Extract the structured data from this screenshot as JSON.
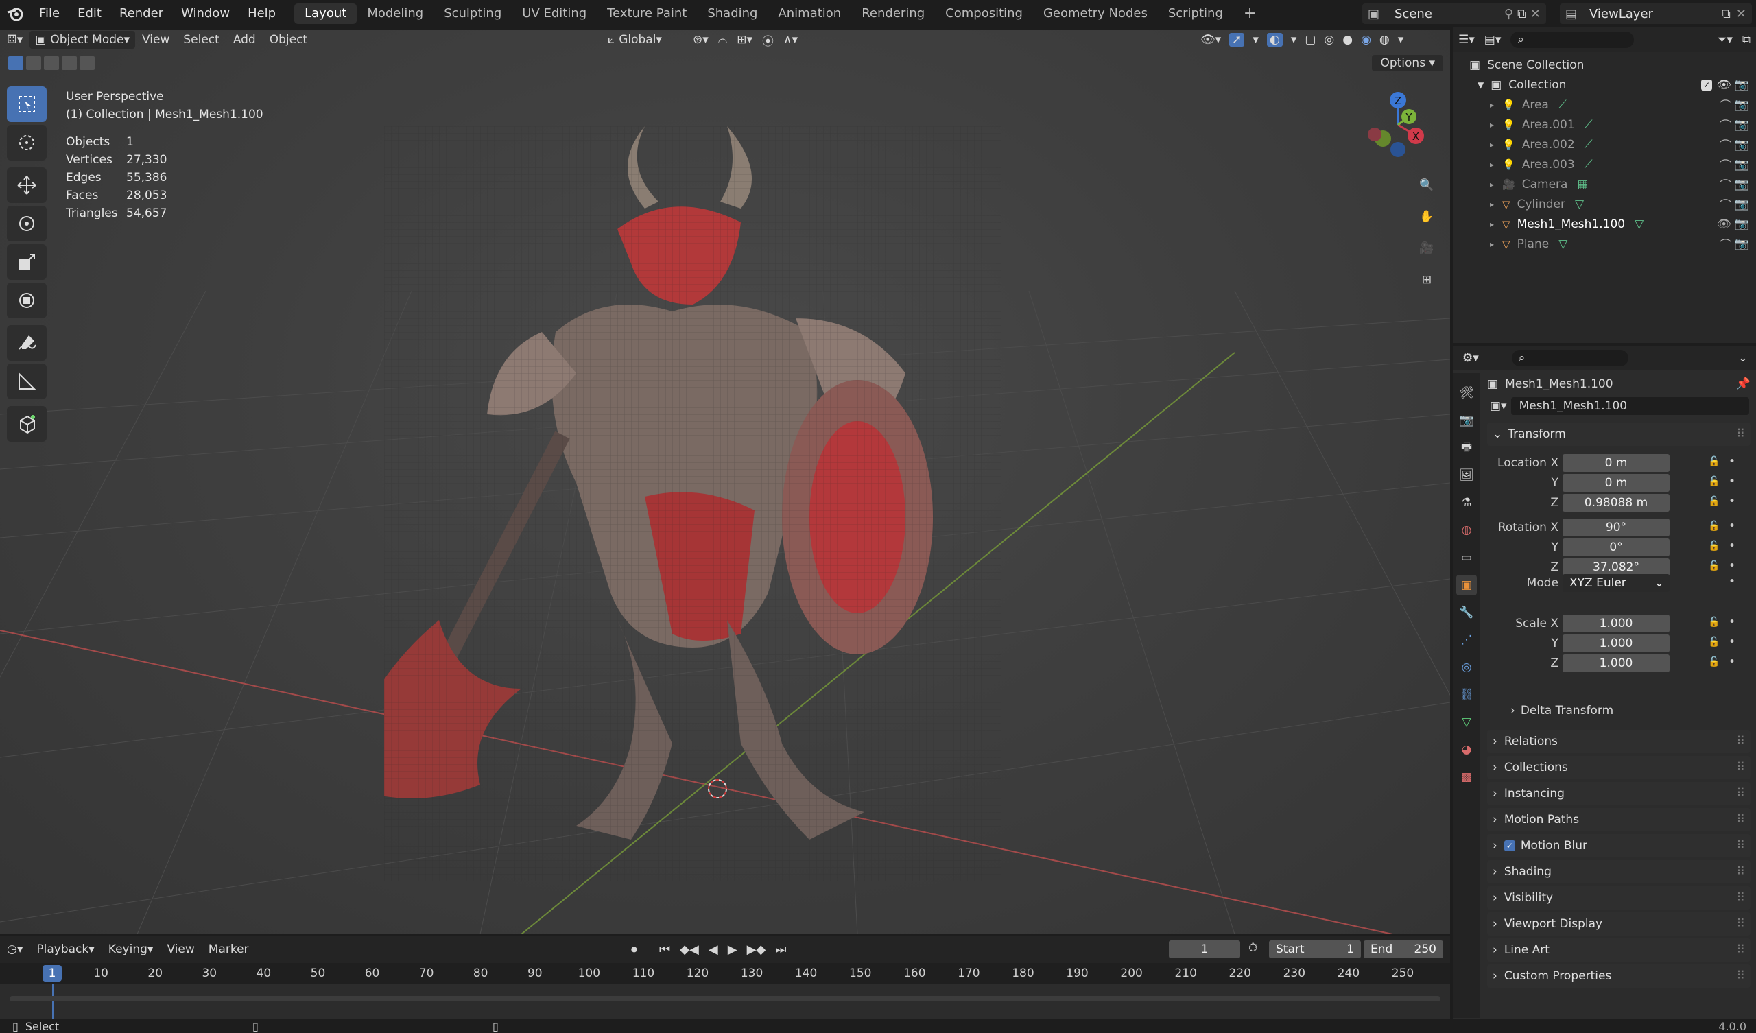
{
  "topbar": {
    "menus": [
      "File",
      "Edit",
      "Render",
      "Window",
      "Help"
    ],
    "workspaces": [
      "Layout",
      "Modeling",
      "Sculpting",
      "UV Editing",
      "Texture Paint",
      "Shading",
      "Animation",
      "Rendering",
      "Compositing",
      "Geometry Nodes",
      "Scripting"
    ],
    "active_workspace": "Layout",
    "scene": "Scene",
    "view_layer": "ViewLayer"
  },
  "viewport": {
    "mode": "Object Mode",
    "menus": [
      "View",
      "Select",
      "Add",
      "Object"
    ],
    "orientation": "Global",
    "options_label": "Options",
    "info_title": "User Perspective",
    "info_collection": "(1) Collection | Mesh1_Mesh1.100",
    "stats": [
      {
        "label": "Objects",
        "value": "1"
      },
      {
        "label": "Vertices",
        "value": "27,330"
      },
      {
        "label": "Edges",
        "value": "55,386"
      },
      {
        "label": "Faces",
        "value": "28,053"
      },
      {
        "label": "Triangles",
        "value": "54,657"
      }
    ],
    "gizmo": {
      "x": "X",
      "y": "Y",
      "z": "Z"
    },
    "accent": "#4772b3"
  },
  "timeline": {
    "menus": [
      "Playback",
      "Keying",
      "View",
      "Marker"
    ],
    "current_frame": "1",
    "start_label": "Start",
    "start": "1",
    "end_label": "End",
    "end": "250",
    "ticks": [
      "1",
      "10",
      "20",
      "30",
      "40",
      "50",
      "60",
      "70",
      "80",
      "90",
      "100",
      "110",
      "120",
      "130",
      "140",
      "150",
      "160",
      "170",
      "180",
      "190",
      "200",
      "210",
      "220",
      "230",
      "240",
      "250"
    ]
  },
  "statusbar": {
    "left": "Select",
    "version": "4.0.0"
  },
  "outliner": {
    "root": "Scene Collection",
    "collection": "Collection",
    "items": [
      {
        "name": "Area",
        "type": "light",
        "selected": false
      },
      {
        "name": "Area.001",
        "type": "light",
        "selected": false
      },
      {
        "name": "Area.002",
        "type": "light",
        "selected": false
      },
      {
        "name": "Area.003",
        "type": "light",
        "selected": false
      },
      {
        "name": "Camera",
        "type": "camera",
        "selected": false
      },
      {
        "name": "Cylinder",
        "type": "mesh",
        "selected": false
      },
      {
        "name": "Mesh1_Mesh1.100",
        "type": "mesh",
        "selected": true
      },
      {
        "name": "Plane",
        "type": "mesh",
        "selected": false
      }
    ]
  },
  "properties": {
    "object_name": "Mesh1_Mesh1.100",
    "datablock_name": "Mesh1_Mesh1.100",
    "transform_label": "Transform",
    "location_label": "Location X",
    "rotation_label": "Rotation X",
    "scale_label": "Scale X",
    "y_label": "Y",
    "z_label": "Z",
    "mode_label": "Mode",
    "mode_value": "XYZ Euler",
    "location": [
      "0 m",
      "0 m",
      "0.98088 m"
    ],
    "rotation": [
      "90°",
      "0°",
      "37.082°"
    ],
    "scale": [
      "1.000",
      "1.000",
      "1.000"
    ],
    "delta_transform": "Delta Transform",
    "panels": [
      "Relations",
      "Collections",
      "Instancing",
      "Motion Paths",
      "Motion Blur",
      "Shading",
      "Visibility",
      "Viewport Display",
      "Line Art",
      "Custom Properties"
    ]
  }
}
